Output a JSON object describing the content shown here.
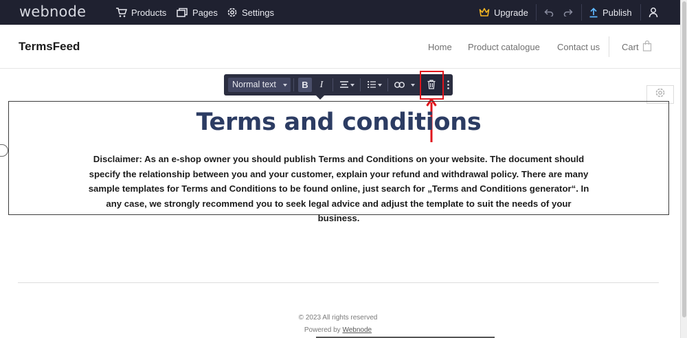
{
  "editor": {
    "logo": "webnode",
    "nav": [
      {
        "label": "Products",
        "icon": "cart-icon"
      },
      {
        "label": "Pages",
        "icon": "pages-icon"
      },
      {
        "label": "Settings",
        "icon": "gear-icon"
      }
    ],
    "upgrade_label": "Upgrade",
    "publish_label": "Publish",
    "accent_color": "#f5b622"
  },
  "site": {
    "brand": "TermsFeed",
    "nav": [
      "Home",
      "Product catalogue",
      "Contact us"
    ],
    "cart_label": "Cart"
  },
  "text_toolbar": {
    "style_select": "Normal text",
    "bold_label": "B",
    "italic_label": "I",
    "highlight_color": "#e0151c"
  },
  "content": {
    "title": "Terms and conditions",
    "disclaimer": "Disclaimer: As an e-shop owner you should publish Terms and Conditions on your website. The document should specify the relationship between you and your customer, explain your refund and withdrawal policy. There are many sample templates for Terms and Conditions to be found online, just search for „Terms and Conditions generator“. In any case, we strongly recommend you to seek legal advice and adjust the template to suit the needs of your business."
  },
  "footer": {
    "copyright": "© 2023 All rights reserved",
    "powered_prefix": "Powered by ",
    "powered_link": "Webnode"
  }
}
